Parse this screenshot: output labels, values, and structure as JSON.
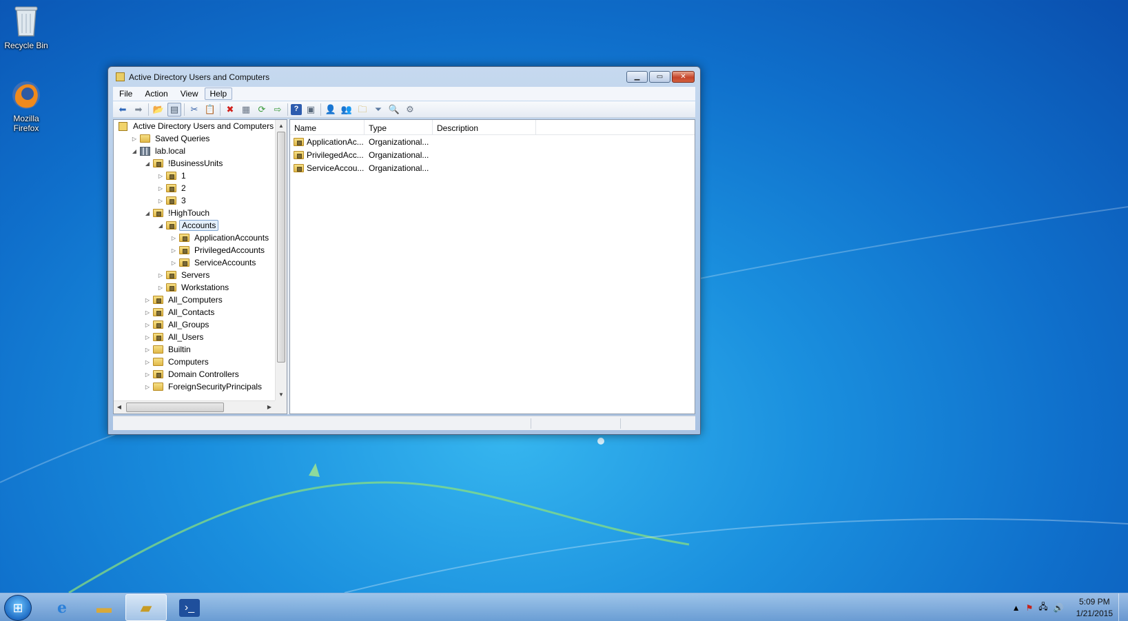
{
  "desktop": {
    "icons": [
      {
        "label": "Recycle Bin",
        "icon": "recycle-bin-icon"
      },
      {
        "label": "Mozilla Firefox",
        "icon": "firefox-icon"
      }
    ]
  },
  "window": {
    "title": "Active Directory Users and Computers",
    "menu": [
      "File",
      "Action",
      "View",
      "Help"
    ],
    "active_menu": "Help",
    "toolbar_icons": [
      "back-icon",
      "forward-icon",
      "up-folder-icon",
      "console-tree-icon",
      "cut-icon",
      "copy-icon",
      "delete-icon",
      "properties-icon",
      "refresh-icon",
      "export-icon",
      "help-icon",
      "show-hide-icon",
      "new-user-icon",
      "new-group-icon",
      "new-ou-icon",
      "filter-icon",
      "find-icon",
      "delegate-icon"
    ]
  },
  "tree": {
    "items": [
      {
        "label": "Active Directory Users and Computers [la",
        "level": 0,
        "expander": "",
        "icon": "aduc"
      },
      {
        "label": "Saved Queries",
        "level": 1,
        "expander": "closed",
        "icon": "folder"
      },
      {
        "label": "lab.local",
        "level": 1,
        "expander": "open",
        "icon": "domain"
      },
      {
        "label": "!BusinessUnits",
        "level": 2,
        "expander": "open",
        "icon": "ou"
      },
      {
        "label": "1",
        "level": 3,
        "expander": "closed",
        "icon": "ou"
      },
      {
        "label": "2",
        "level": 3,
        "expander": "closed",
        "icon": "ou"
      },
      {
        "label": "3",
        "level": 3,
        "expander": "closed",
        "icon": "ou"
      },
      {
        "label": "!HighTouch",
        "level": 2,
        "expander": "open",
        "icon": "ou"
      },
      {
        "label": "Accounts",
        "level": 3,
        "expander": "open",
        "icon": "ou",
        "selected": true
      },
      {
        "label": "ApplicationAccounts",
        "level": 4,
        "expander": "closed",
        "icon": "ou"
      },
      {
        "label": "PrivilegedAccounts",
        "level": 4,
        "expander": "closed",
        "icon": "ou"
      },
      {
        "label": "ServiceAccounts",
        "level": 4,
        "expander": "closed",
        "icon": "ou"
      },
      {
        "label": "Servers",
        "level": 3,
        "expander": "closed",
        "icon": "ou"
      },
      {
        "label": "Workstations",
        "level": 3,
        "expander": "closed",
        "icon": "ou"
      },
      {
        "label": "All_Computers",
        "level": 2,
        "expander": "closed",
        "icon": "ou"
      },
      {
        "label": "All_Contacts",
        "level": 2,
        "expander": "closed",
        "icon": "ou"
      },
      {
        "label": "All_Groups",
        "level": 2,
        "expander": "closed",
        "icon": "ou"
      },
      {
        "label": "All_Users",
        "level": 2,
        "expander": "closed",
        "icon": "ou"
      },
      {
        "label": "Builtin",
        "level": 2,
        "expander": "closed",
        "icon": "folder"
      },
      {
        "label": "Computers",
        "level": 2,
        "expander": "closed",
        "icon": "folder"
      },
      {
        "label": "Domain Controllers",
        "level": 2,
        "expander": "closed",
        "icon": "ou"
      },
      {
        "label": "ForeignSecurityPrincipals",
        "level": 2,
        "expander": "closed",
        "icon": "folder"
      }
    ]
  },
  "list": {
    "columns": [
      "Name",
      "Type",
      "Description"
    ],
    "rows": [
      {
        "name": "ApplicationAc...",
        "type": "Organizational..."
      },
      {
        "name": "PrivilegedAcc...",
        "type": "Organizational..."
      },
      {
        "name": "ServiceAccou...",
        "type": "Organizational..."
      }
    ]
  },
  "taskbar": {
    "time": "5:09 PM",
    "date": "1/21/2015"
  }
}
